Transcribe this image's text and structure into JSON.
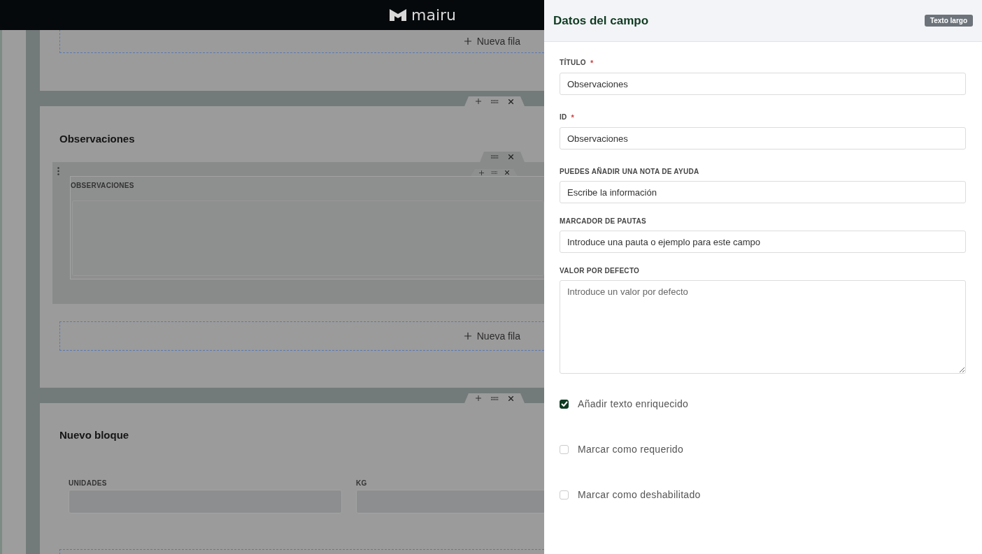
{
  "header": {
    "logo_text": "mairu"
  },
  "canvas": {
    "blocks": [
      {
        "new_row": "Nueva fila"
      },
      {
        "title": "Observaciones",
        "fields": [
          {
            "label": "OBSERVACIONES",
            "kind": "textarea"
          }
        ],
        "new_row": "Nueva fila"
      },
      {
        "title": "Nuevo bloque",
        "fields": [
          {
            "label": "UNIDADES",
            "kind": "input"
          },
          {
            "label": "KG",
            "kind": "input"
          }
        ]
      }
    ]
  },
  "panel": {
    "title": "Datos del campo",
    "badge": "Texto largo",
    "fields": [
      {
        "label": "TÍTULO",
        "required_mark": "*",
        "kind": "input",
        "value": "Observaciones"
      },
      {
        "label": "ID",
        "required_mark": "*",
        "kind": "input",
        "value": "Observaciones"
      },
      {
        "label": "PUEDES AÑADIR UNA NOTA DE AYUDA",
        "kind": "input",
        "value": "Escribe la información"
      },
      {
        "label": "MARCADOR DE PAUTAS",
        "kind": "input",
        "value": "Introduce una pauta o ejemplo para este campo"
      },
      {
        "label": "VALOR POR DEFECTO",
        "kind": "textarea",
        "placeholder": "Introduce un valor por defecto"
      }
    ],
    "checkboxes": [
      {
        "label": "Añadir texto enriquecido",
        "checked": true
      },
      {
        "label": "Marcar como requerido",
        "checked": false
      },
      {
        "label": "Marcar como deshabilitado",
        "checked": false
      }
    ]
  }
}
